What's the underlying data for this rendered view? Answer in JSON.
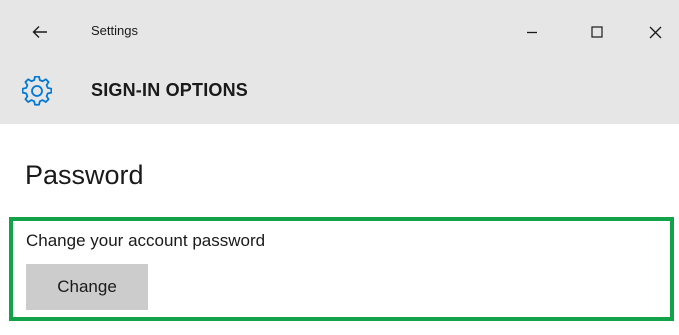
{
  "titlebar": {
    "back_icon": "arrow-left-icon",
    "app_title": "Settings",
    "minimize_icon": "minimize-icon",
    "maximize_icon": "maximize-icon",
    "close_icon": "close-icon"
  },
  "header": {
    "icon": "gear-icon",
    "title": "SIGN-IN OPTIONS"
  },
  "main": {
    "heading": "Password",
    "description": "Change your account password",
    "change_button": "Change"
  },
  "colors": {
    "chrome_bg": "#e6e6e6",
    "accent": "#0078d7",
    "highlight_border": "#12a24a",
    "button_bg": "#cccccc"
  }
}
